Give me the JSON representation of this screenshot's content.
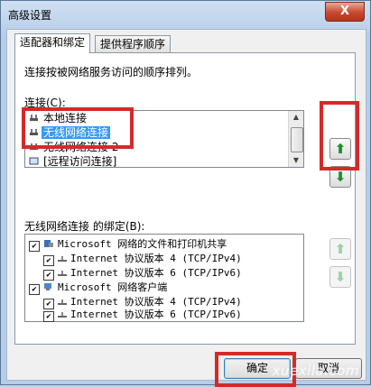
{
  "window": {
    "title": "高级设置",
    "close_symbol": "X"
  },
  "tabs": [
    {
      "label": "适配器和绑定",
      "active": true
    },
    {
      "label": "提供程序顺序",
      "active": false
    }
  ],
  "description": "连接按被网络服务访问的顺序排列。",
  "connections": {
    "label": "连接(C):",
    "items": [
      {
        "label": "本地连接",
        "icon": "network-connection-icon",
        "selected": false
      },
      {
        "label": "无线网络连接",
        "icon": "network-connection-icon",
        "selected": true
      },
      {
        "label": "无线网络连接 2",
        "icon": "network-connection-icon",
        "selected": false
      },
      {
        "label": "[远程访问连接]",
        "icon": "remote-access-icon",
        "selected": false
      }
    ]
  },
  "move_buttons": {
    "up": "⬆",
    "down": "⬇"
  },
  "bindings": {
    "label": "无线网络连接 的绑定(B):",
    "items": [
      {
        "label": "Microsoft 网络的文件和打印机共享",
        "level": 0,
        "checked": true,
        "icon": "file-printer-sharing-icon"
      },
      {
        "label": "Internet 协议版本 4 (TCP/IPv4)",
        "level": 1,
        "checked": true,
        "icon": "protocol-icon"
      },
      {
        "label": "Internet 协议版本 6 (TCP/IPv6)",
        "level": 1,
        "checked": true,
        "icon": "protocol-icon"
      },
      {
        "label": "Microsoft 网络客户端",
        "level": 0,
        "checked": true,
        "icon": "network-client-icon"
      },
      {
        "label": "Internet 协议版本 4 (TCP/IPv4)",
        "level": 1,
        "checked": true,
        "icon": "protocol-icon"
      },
      {
        "label": "Internet 协议版本 6 (TCP/IPv6)",
        "level": 1,
        "checked": true,
        "icon": "protocol-icon"
      }
    ],
    "check_mark": "✔"
  },
  "footer": {
    "ok_label": "确定",
    "cancel_label": "取消"
  },
  "watermark": "xuexila.com",
  "colors": {
    "selection": "#3399ff",
    "highlight": "#d42a2a",
    "arrow_green": "#1f8f2b"
  }
}
